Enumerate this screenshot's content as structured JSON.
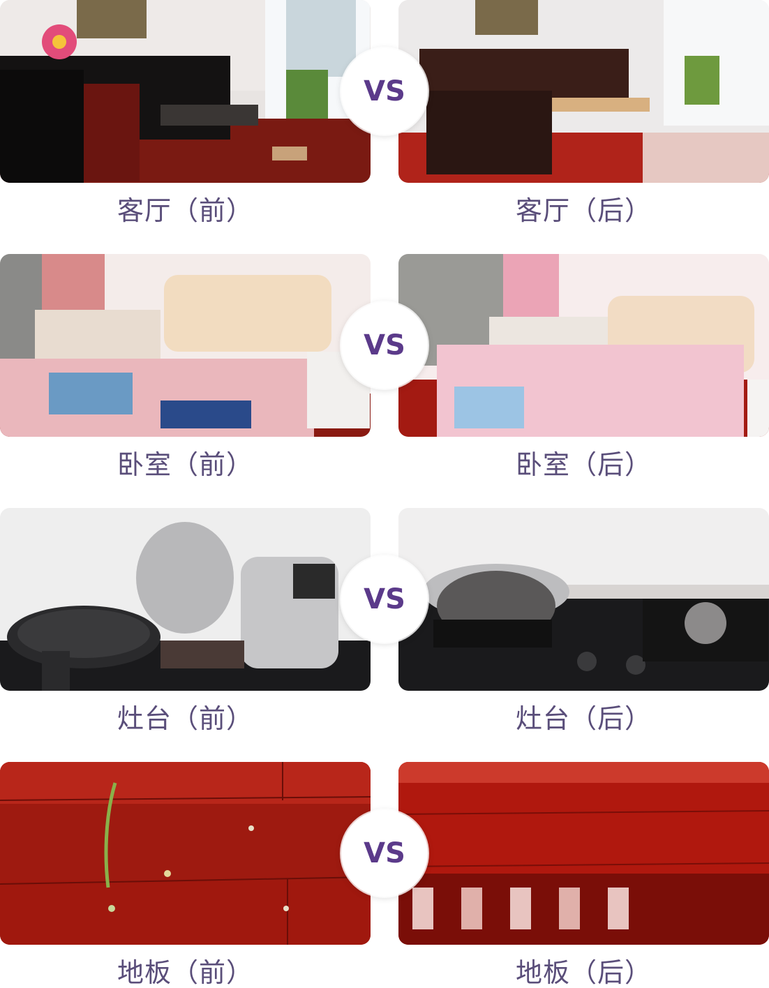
{
  "vs_label": "VS",
  "rows": [
    {
      "before": "客厅（前）",
      "after": "客厅（后）"
    },
    {
      "before": "卧室（前）",
      "after": "卧室（后）"
    },
    {
      "before": "灶台（前）",
      "after": "灶台（后）"
    },
    {
      "before": "地板（前）",
      "after": "地板（后）"
    }
  ],
  "colors": {
    "caption": "#5a4e7a",
    "vs_text": "#5b3a8a",
    "floor_red": "#a3190f"
  }
}
